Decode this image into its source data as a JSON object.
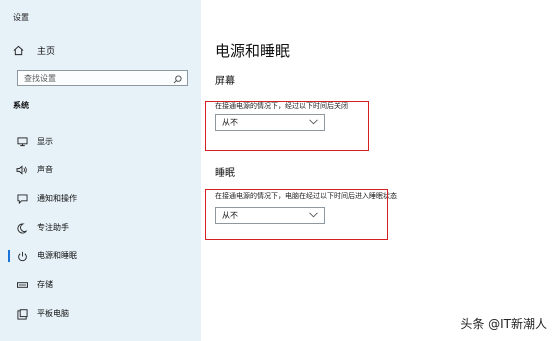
{
  "app": {
    "title": "设置"
  },
  "sidebar": {
    "home_label": "主页",
    "search_placeholder": "查找设置",
    "section_label": "系统",
    "items": [
      {
        "label": "显示",
        "icon": "monitor-icon"
      },
      {
        "label": "声音",
        "icon": "speaker-icon"
      },
      {
        "label": "通知和操作",
        "icon": "notification-icon"
      },
      {
        "label": "专注助手",
        "icon": "moon-icon"
      },
      {
        "label": "电源和睡眠",
        "icon": "power-icon",
        "active": true
      },
      {
        "label": "存储",
        "icon": "storage-icon"
      },
      {
        "label": "平板电脑",
        "icon": "tablet-icon"
      }
    ]
  },
  "main": {
    "title": "电源和睡眠",
    "screen": {
      "heading": "屏幕",
      "description": "在接通电源的情况下，经过以下时间后关闭",
      "selected": "从不"
    },
    "sleep": {
      "heading": "睡眠",
      "description": "在接通电源的情况下，电脑在经过以下时间后进入睡眠状态",
      "selected": "从不"
    }
  },
  "watermark": "头条 @IT新潮人",
  "colors": {
    "sidebar_bg": "#e6f1f8",
    "accent": "#1a73d9",
    "highlight": "#d42020"
  }
}
